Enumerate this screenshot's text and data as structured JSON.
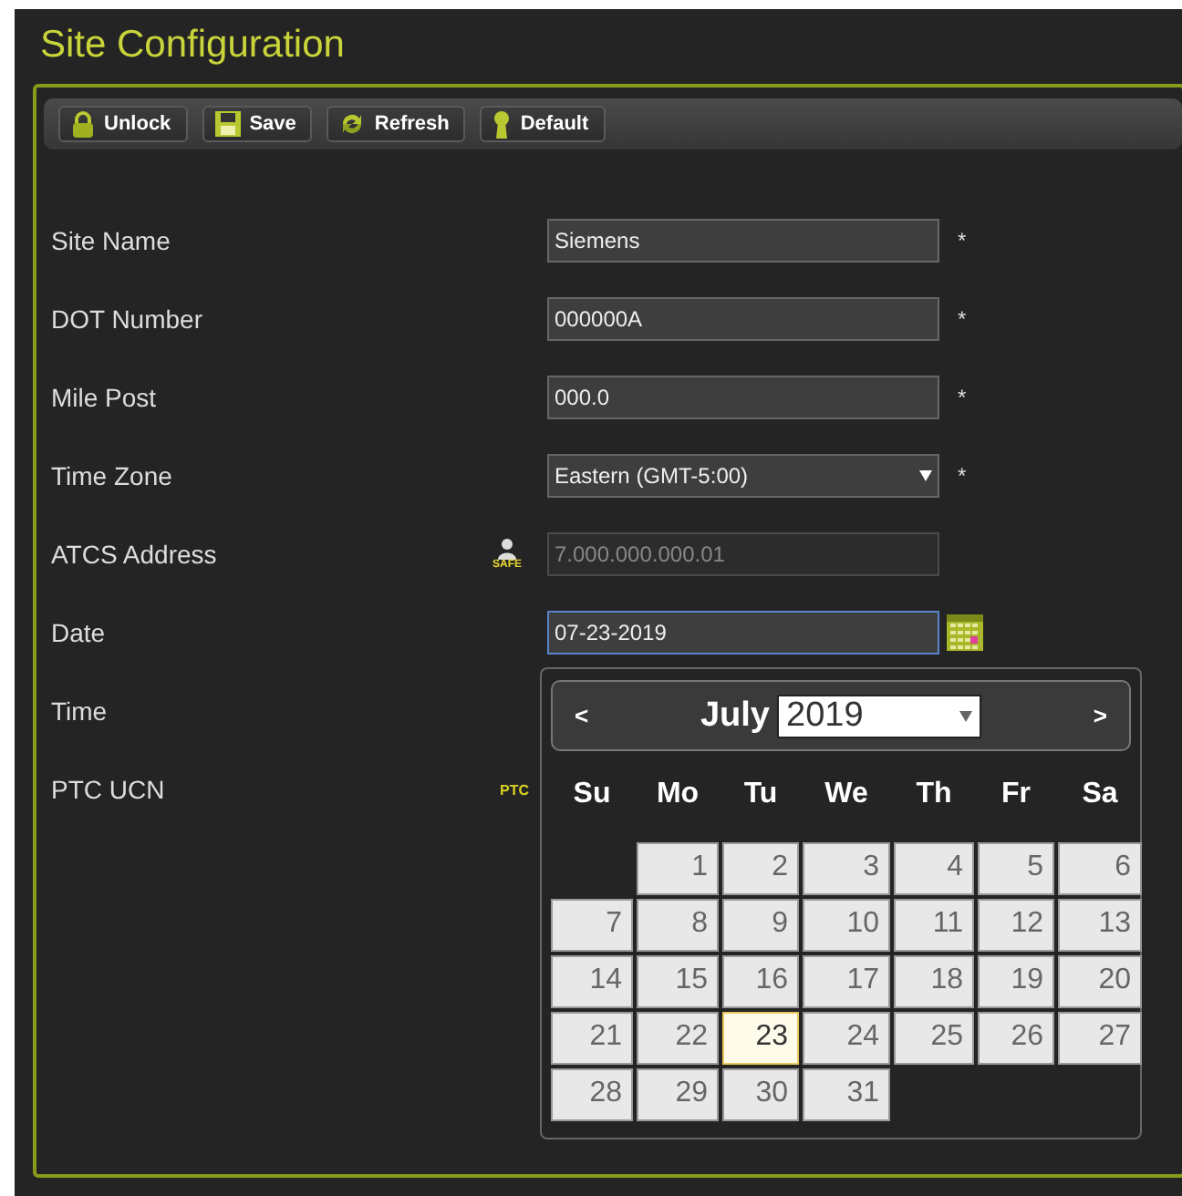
{
  "page": {
    "title": "Site Configuration"
  },
  "toolbar": [
    {
      "label": "Unlock",
      "kind": "lock"
    },
    {
      "label": "Save",
      "kind": "save"
    },
    {
      "label": "Refresh",
      "kind": "refresh"
    },
    {
      "label": "Default",
      "kind": "default"
    }
  ],
  "fields": [
    {
      "label": "Site Name",
      "kind": "text",
      "value": "Siemens",
      "required": "*"
    },
    {
      "label": "DOT Number",
      "kind": "text",
      "value": "000000A",
      "required": "*"
    },
    {
      "label": "Mile Post",
      "kind": "text",
      "value": "000.0",
      "required": "*"
    },
    {
      "label": "Time Zone",
      "kind": "select",
      "value": "Eastern (GMT-5:00)",
      "required": "*"
    },
    {
      "label": "ATCS Address",
      "kind": "disabled",
      "value": "7.000.000.000.01",
      "badge": "SAFE"
    },
    {
      "label": "Date",
      "kind": "date",
      "value": "07-23-2019"
    },
    {
      "label": "Time",
      "kind": "hidden"
    },
    {
      "label": "PTC UCN",
      "kind": "hidden",
      "badge": "PTC"
    }
  ],
  "calendar": {
    "prev": "<",
    "next": ">",
    "month": "July",
    "year": "2019",
    "weekdays": [
      "Su",
      "Mo",
      "Tu",
      "We",
      "Th",
      "Fr",
      "Sa"
    ],
    "weeks": [
      [
        {
          "kind": "blank"
        },
        {
          "day": "1",
          "selected": false
        },
        {
          "day": "2",
          "selected": false
        },
        {
          "day": "3",
          "selected": false
        },
        {
          "day": "4",
          "selected": false
        },
        {
          "day": "5",
          "selected": false
        },
        {
          "day": "6",
          "selected": false
        }
      ],
      [
        {
          "day": "7",
          "selected": false
        },
        {
          "day": "8",
          "selected": false
        },
        {
          "day": "9",
          "selected": false
        },
        {
          "day": "10",
          "selected": false
        },
        {
          "day": "11",
          "selected": false
        },
        {
          "day": "12",
          "selected": false
        },
        {
          "day": "13",
          "selected": false
        }
      ],
      [
        {
          "day": "14",
          "selected": false
        },
        {
          "day": "15",
          "selected": false
        },
        {
          "day": "16",
          "selected": false
        },
        {
          "day": "17",
          "selected": false
        },
        {
          "day": "18",
          "selected": false
        },
        {
          "day": "19",
          "selected": false
        },
        {
          "day": "20",
          "selected": false
        }
      ],
      [
        {
          "day": "21",
          "selected": false
        },
        {
          "day": "22",
          "selected": false
        },
        {
          "day": "23",
          "selected": true
        },
        {
          "day": "24",
          "selected": false
        },
        {
          "day": "25",
          "selected": false
        },
        {
          "day": "26",
          "selected": false
        },
        {
          "day": "27",
          "selected": false
        }
      ],
      [
        {
          "day": "28",
          "selected": false
        },
        {
          "day": "29",
          "selected": false
        },
        {
          "day": "30",
          "selected": false
        },
        {
          "day": "31",
          "selected": false
        },
        {
          "kind": "blank"
        },
        {
          "kind": "blank"
        },
        {
          "kind": "blank"
        }
      ]
    ]
  }
}
